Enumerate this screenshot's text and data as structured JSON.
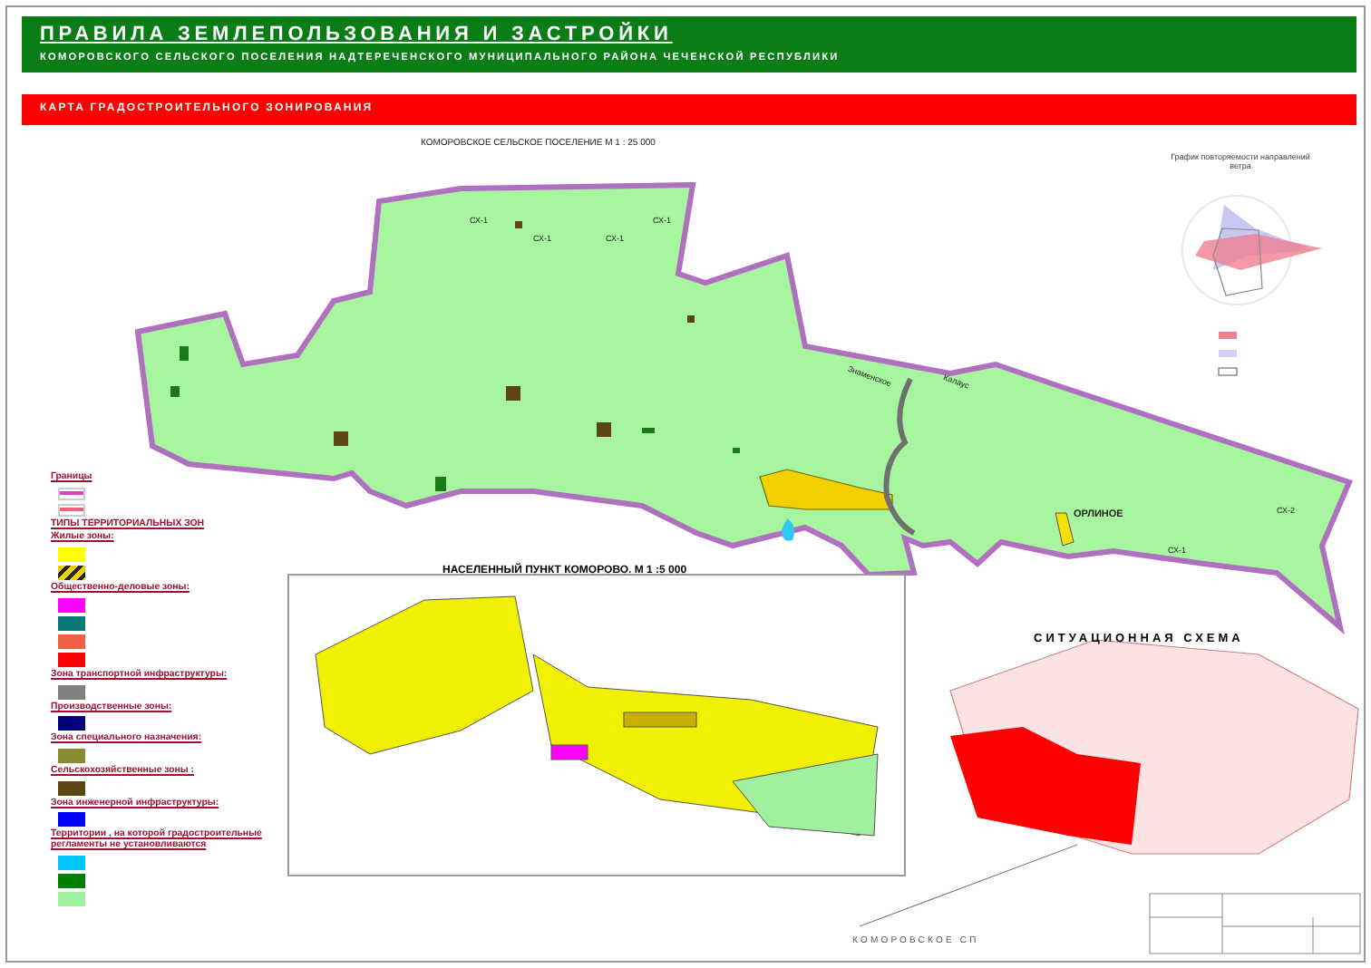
{
  "header": {
    "title": "ПРАВИЛА ЗЕМЛЕПОЛЬЗОВАНИЯ И ЗАСТРОЙКИ",
    "subtitle": "КОМОРОВСКОГО СЕЛЬСКОГО ПОСЕЛЕНИЯ НАДТЕРЕЧЕНСКОГО МУНИЦИПАЛЬНОГО РАЙОНА  ЧЕЧЕНСКОЙ РЕСПУБЛИКИ"
  },
  "section": {
    "title": "КАРТА ГРАДОСТРОИТЕЛЬНОГО ЗОНИРОВАНИЯ"
  },
  "map": {
    "title": "КОМОРОВСКОЕ  СЕЛЬСКОЕ ПОСЕЛЕНИЕ М 1 : 25 000",
    "labels": [
      {
        "text": "СХ-1",
        "kind": "zone"
      },
      {
        "text": "СХ-1",
        "kind": "zone"
      },
      {
        "text": "СХ-1",
        "kind": "zone"
      },
      {
        "text": "СХ-1",
        "kind": "zone"
      },
      {
        "text": "Знаменское",
        "kind": "road"
      },
      {
        "text": "Калаус",
        "kind": "road"
      },
      {
        "text": "ОРЛИНОЕ",
        "kind": "settlement"
      },
      {
        "text": "СХ-2",
        "kind": "zone"
      },
      {
        "text": "СХ-1",
        "kind": "zone"
      }
    ]
  },
  "wind": {
    "title": "График повторяемости направлений ветра"
  },
  "inset": {
    "title": "НАСЕЛЕННЫЙ ПУНКТ КОМОРОВО. М 1 :5 000"
  },
  "situation": {
    "title": "СИТУАЦИОННАЯ СХЕМА",
    "callout": "КОМОРОВСКОЕ СП"
  },
  "legend": [
    {
      "kind": "heading",
      "text": "Границы"
    },
    {
      "kind": "line",
      "color": "#e040c0"
    },
    {
      "kind": "line",
      "color": "#f06080"
    },
    {
      "kind": "heading",
      "text": "ТИПЫ ТЕРРИТОРИАЛЬНЫХ ЗОН"
    },
    {
      "kind": "heading",
      "text": "Жилые зоны:"
    },
    {
      "kind": "solid",
      "color": "#ffff00"
    },
    {
      "kind": "hatched",
      "color": "#f0d000"
    },
    {
      "kind": "heading",
      "text": "Общественно-деловые зоны:"
    },
    {
      "kind": "solid",
      "color": "#ff00ff"
    },
    {
      "kind": "solid",
      "color": "#0a7878"
    },
    {
      "kind": "solid",
      "color": "#f06040"
    },
    {
      "kind": "solid",
      "color": "#ff0000"
    },
    {
      "kind": "heading",
      "text": "Зона транспортной  инфраструктуры:"
    },
    {
      "kind": "solid",
      "color": "#808080"
    },
    {
      "kind": "heading",
      "text": "Производственные зоны:"
    },
    {
      "kind": "solid",
      "color": "#000080"
    },
    {
      "kind": "heading",
      "text": "Зона специального назначения:"
    },
    {
      "kind": "solid",
      "color": "#8a8a30"
    },
    {
      "kind": "heading",
      "text": "Сельскохозяйственные зоны :"
    },
    {
      "kind": "solid",
      "color": "#5a4610"
    },
    {
      "kind": "heading",
      "text": "Зона инженерной инфраструктуры:"
    },
    {
      "kind": "solid",
      "color": "#0000ff"
    },
    {
      "kind": "heading",
      "text": "Территории , на которой градостроительные регламенты не установливаются"
    },
    {
      "kind": "solid",
      "color": "#00c8ff"
    },
    {
      "kind": "solid",
      "color": "#008000"
    },
    {
      "kind": "solid",
      "color": "#a0f0a0"
    }
  ]
}
